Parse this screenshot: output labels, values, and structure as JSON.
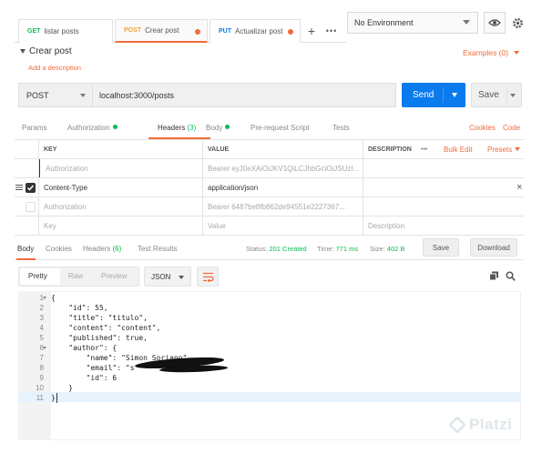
{
  "tabs": [
    {
      "method": "GET",
      "label": "listar posts",
      "active": false,
      "unsaved": false
    },
    {
      "method": "POST",
      "label": "Crear post",
      "active": true,
      "unsaved": true
    },
    {
      "method": "PUT",
      "label": "Actualizar post",
      "active": false,
      "unsaved": true
    }
  ],
  "environment": {
    "selected": "No Environment"
  },
  "request": {
    "name": "Crear post",
    "add_description": "Add a description",
    "examples": "Examples (0)",
    "method": "POST",
    "url": "localhost:3000/posts",
    "send_label": "Send",
    "save_label": "Save"
  },
  "request_tabs": {
    "params": "Params",
    "authorization": "Authorization",
    "headers": "Headers",
    "headers_count": "(3)",
    "body": "Body",
    "prerequest": "Pre-request Script",
    "tests": "Tests",
    "cookies": "Cookies",
    "code": "Code"
  },
  "headers_table": {
    "col_key": "KEY",
    "col_value": "VALUE",
    "col_description": "DESCRIPTION",
    "more": "•••",
    "bulk_edit": "Bulk Edit",
    "presets": "Presets",
    "rows": [
      {
        "key": "Authorization",
        "value": "Bearer eyJ0eXAiOiJKV1QiLCJhbGciOiJSUzI...",
        "checked": false
      },
      {
        "key": "Content-Type",
        "value": "application/json",
        "checked": true
      },
      {
        "key": "Authorization",
        "value": "Bearer 6487be8fb862de94551e2227367...",
        "checked": false
      }
    ],
    "placeholder": {
      "key": "Key",
      "value": "Value",
      "description": "Description"
    }
  },
  "response": {
    "tabs": {
      "body": "Body",
      "cookies": "Cookies",
      "headers": "Headers",
      "headers_count": "(6)",
      "test_results": "Test Results"
    },
    "status_label": "Status:",
    "status_value": "201 Created",
    "time_label": "Time:",
    "time_value": "771 ms",
    "size_label": "Size:",
    "size_value": "402 B",
    "save_label": "Save",
    "download_label": "Download",
    "formats": {
      "pretty": "Pretty",
      "raw": "Raw",
      "preview": "Preview"
    },
    "language": "JSON",
    "code_lines": [
      {
        "n": "1",
        "text": "{",
        "fold": true
      },
      {
        "n": "2",
        "text": "    \"id\": 55,",
        "fold": false
      },
      {
        "n": "3",
        "text": "    \"title\": \"titulo\",",
        "fold": false
      },
      {
        "n": "4",
        "text": "    \"content\": \"content\",",
        "fold": false
      },
      {
        "n": "5",
        "text": "    \"published\": true,",
        "fold": false
      },
      {
        "n": "6",
        "text": "    \"author\": {",
        "fold": true
      },
      {
        "n": "7",
        "text": "        \"name\": \"Simon Soriano\",",
        "fold": false
      },
      {
        "n": "8",
        "text": "        \"email\": \"s           n\",",
        "fold": false
      },
      {
        "n": "9",
        "text": "        \"id\": 6",
        "fold": false
      },
      {
        "n": "10",
        "text": "    }",
        "fold": false
      },
      {
        "n": "11",
        "text": "}",
        "fold": false
      }
    ]
  },
  "watermark": "Platzi",
  "colors": {
    "accent": "#f26b3a",
    "send": "#097bed",
    "success": "#0cbb52",
    "get": "#0cbb52",
    "post": "#f2a33a",
    "put": "#097bed"
  }
}
